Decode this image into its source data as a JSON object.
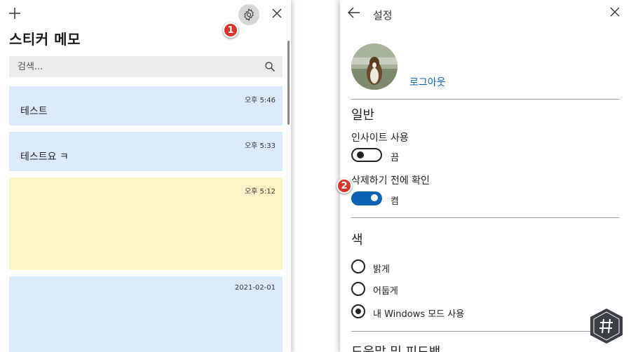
{
  "sticky_notes": {
    "title": "스티커 메모",
    "search_placeholder": "검색...",
    "notes": [
      {
        "time": "오후 5:46",
        "text": "테스트",
        "color": "#dcebfb"
      },
      {
        "time": "오후 5:33",
        "text": "테스트요 ㅋ",
        "color": "#dcebfb"
      },
      {
        "time": "오후 5:12",
        "text": "",
        "color": "#fcf3c7"
      },
      {
        "time": "2021-02-01",
        "text": "",
        "color": "#dcebfb"
      }
    ]
  },
  "settings": {
    "title": "설정",
    "logout": "로그아웃",
    "general_heading": "일반",
    "insights_label": "인사이트 사용",
    "insights_state": "끔",
    "confirm_label": "삭제하기 전에 확인",
    "confirm_state": "켬",
    "color_heading": "색",
    "color_options": [
      "밝게",
      "어둡게",
      "내 Windows 모드 사용"
    ],
    "help_heading": "도움말 및 피드백"
  },
  "markers": [
    "1",
    "2"
  ],
  "colors": {
    "accent": "#0a63b0",
    "marker": "#d8342b"
  }
}
